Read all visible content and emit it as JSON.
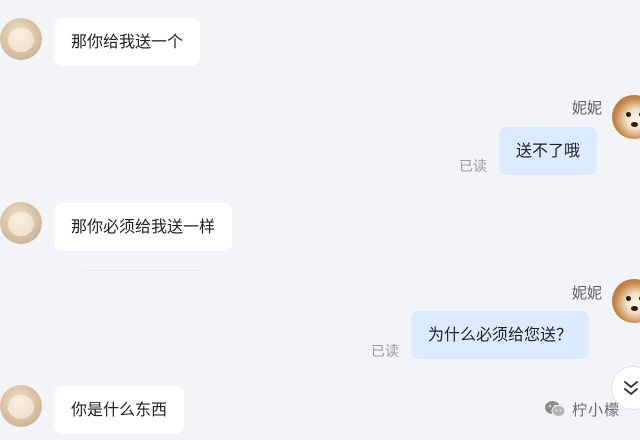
{
  "chat": {
    "contact_name": "妮妮",
    "read_label": "已读",
    "messages": [
      {
        "direction": "incoming",
        "text": "那你给我送一个"
      },
      {
        "direction": "outgoing",
        "text": "送不了哦"
      },
      {
        "direction": "incoming",
        "text": "那你必须给我送一样"
      },
      {
        "direction": "outgoing",
        "text": "为什么必须给您送？"
      },
      {
        "direction": "incoming",
        "text": "你是什么东西"
      }
    ]
  },
  "watermark": {
    "text": "柠小檬"
  },
  "colors": {
    "background": "#f3f4f7",
    "incoming_bubble": "#ffffff",
    "outgoing_bubble": "#dceaff"
  },
  "icons": {
    "scroll_down": "double-chevron-down-icon",
    "watermark_logo": "wechat-icon"
  }
}
